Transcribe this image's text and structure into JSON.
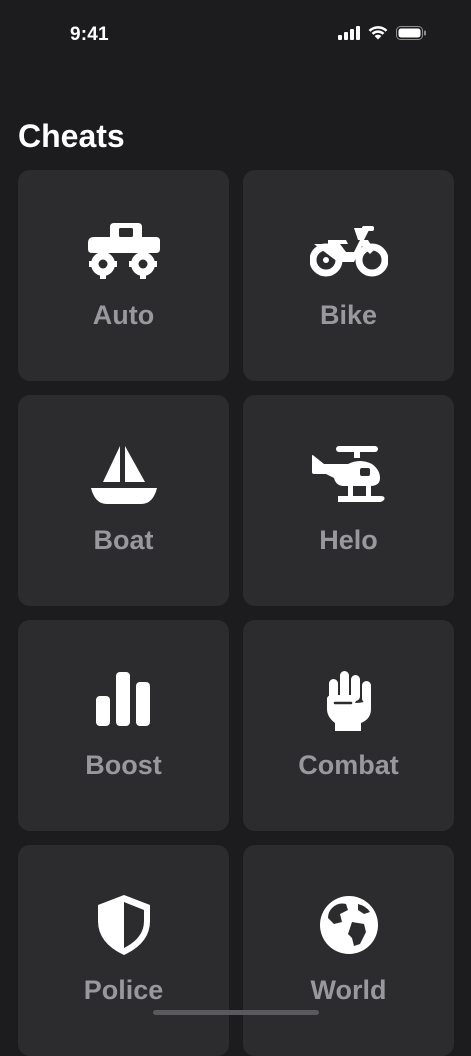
{
  "status_bar": {
    "time": "9:41"
  },
  "header": {
    "title": "Cheats"
  },
  "tiles": [
    {
      "label": "Auto",
      "icon": "monster-truck-icon"
    },
    {
      "label": "Bike",
      "icon": "motorcycle-icon"
    },
    {
      "label": "Boat",
      "icon": "sailboat-icon"
    },
    {
      "label": "Helo",
      "icon": "helicopter-icon"
    },
    {
      "label": "Boost",
      "icon": "bar-chart-icon"
    },
    {
      "label": "Combat",
      "icon": "fist-icon"
    },
    {
      "label": "Police",
      "icon": "shield-icon"
    },
    {
      "label": "World",
      "icon": "globe-icon"
    }
  ],
  "colors": {
    "background": "#1c1c1e",
    "tile": "#2c2c2e",
    "label": "#98989d",
    "icon": "#ffffff"
  }
}
